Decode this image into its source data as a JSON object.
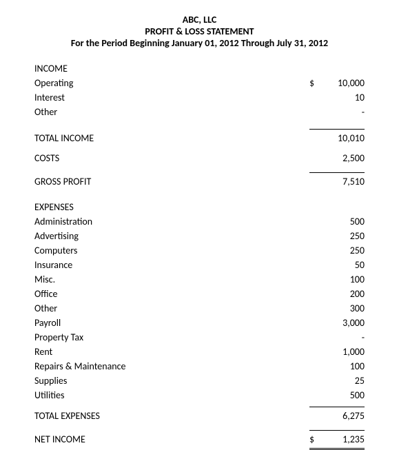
{
  "header": {
    "company": "ABC, LLC",
    "title": "PROFIT & LOSS STATEMENT",
    "period": "For the Period Beginning January 01, 2012 Through  July 31, 2012"
  },
  "sections": {
    "income": {
      "heading": "INCOME",
      "items": [
        {
          "label": "Operating",
          "currency": "$",
          "amount": "10,000"
        },
        {
          "label": "Interest",
          "currency": "",
          "amount": "10"
        },
        {
          "label": "Other",
          "currency": "",
          "amount": "-"
        }
      ],
      "total": {
        "label": "TOTAL INCOME",
        "currency": "",
        "amount": "10,010"
      }
    },
    "costs": {
      "label": "COSTS",
      "amount": "2,500"
    },
    "gross_profit": {
      "label": "GROSS PROFIT",
      "amount": "7,510"
    },
    "expenses": {
      "heading": "EXPENSES",
      "items": [
        {
          "label": "Administration",
          "amount": "500"
        },
        {
          "label": "Advertising",
          "amount": "250"
        },
        {
          "label": "Computers",
          "amount": "250"
        },
        {
          "label": "Insurance",
          "amount": "50"
        },
        {
          "label": "Misc.",
          "amount": "100"
        },
        {
          "label": "Office",
          "amount": "200"
        },
        {
          "label": "Other",
          "amount": "300"
        },
        {
          "label": "Payroll",
          "amount": "3,000"
        },
        {
          "label": "Property Tax",
          "amount": "-"
        },
        {
          "label": "Rent",
          "amount": "1,000"
        },
        {
          "label": "Repairs & Maintenance",
          "amount": "100"
        },
        {
          "label": "Supplies",
          "amount": "25"
        },
        {
          "label": "Utilities",
          "amount": "500"
        }
      ],
      "total": {
        "label": "TOTAL EXPENSES",
        "amount": "6,275"
      }
    },
    "net_income": {
      "label": "NET INCOME",
      "currency": "$",
      "amount": "1,235"
    }
  }
}
